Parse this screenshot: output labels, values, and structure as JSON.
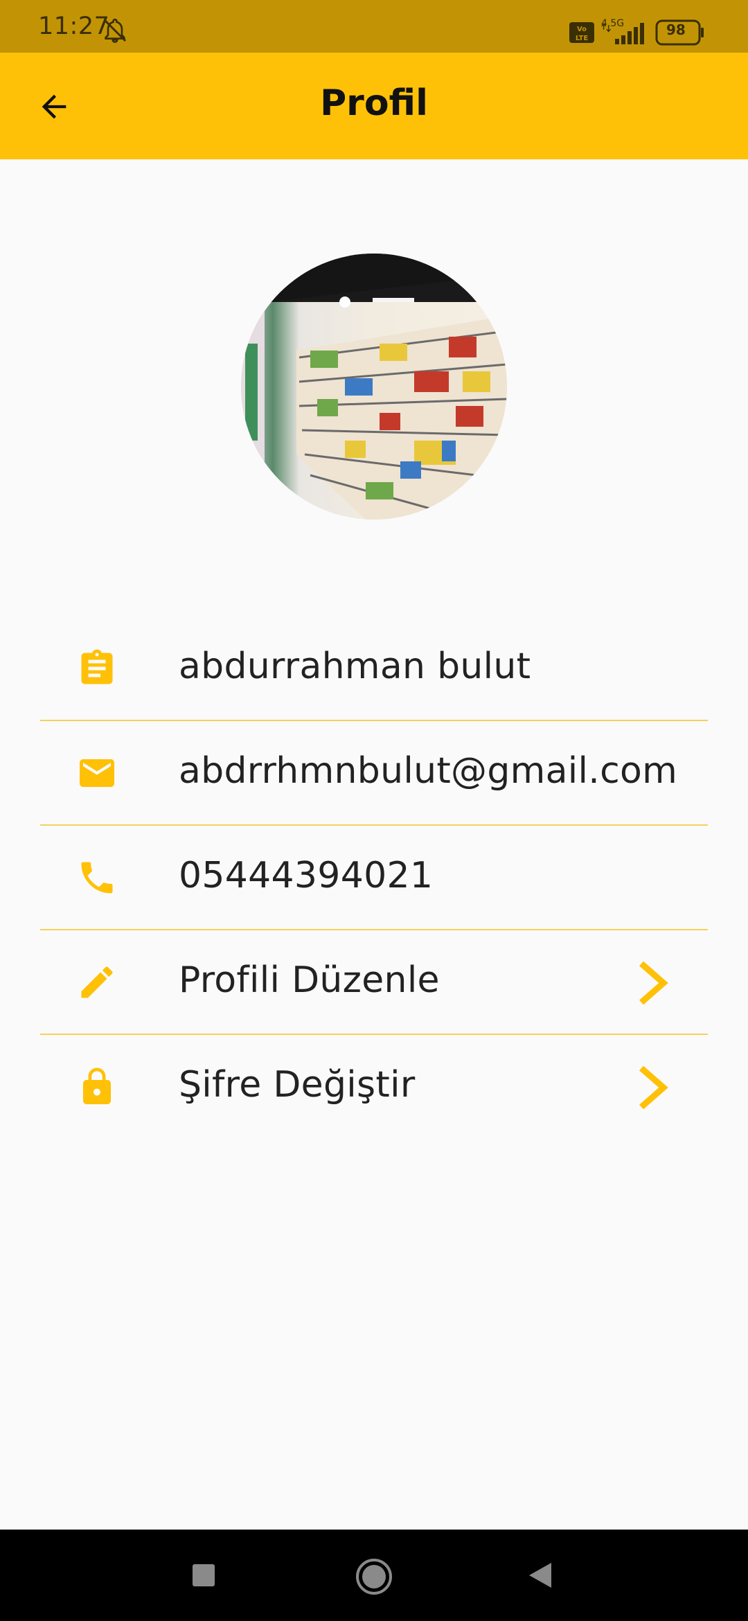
{
  "status_bar": {
    "time": "11:27",
    "network": "4.5G",
    "volte": "Vo LTE",
    "battery": "98"
  },
  "app_bar": {
    "title": "Profil",
    "back_icon": "arrow-back-icon"
  },
  "avatar": {
    "icon": "profile-photo-supermarket-shelves"
  },
  "profile_items": [
    {
      "icon": "assignment-icon",
      "label": "abdurrahman bulut",
      "has_chevron": false
    },
    {
      "icon": "mail-icon",
      "label": "abdrrhmnbulut@gmail.com",
      "has_chevron": false
    },
    {
      "icon": "phone-icon",
      "label": "05444394021",
      "has_chevron": false
    },
    {
      "icon": "edit-pencil-icon",
      "label": "Profili Düzenle",
      "has_chevron": true
    },
    {
      "icon": "lock-icon",
      "label": "Şifre Değiştir",
      "has_chevron": true
    }
  ],
  "nav_bar": {
    "buttons": [
      "recents-square-icon",
      "home-circle-icon",
      "back-triangle-icon"
    ]
  },
  "colors": {
    "accent": "#ffc107",
    "status_bar": "#c29405",
    "divider": "#f3d15a",
    "background": "#fafafa"
  }
}
